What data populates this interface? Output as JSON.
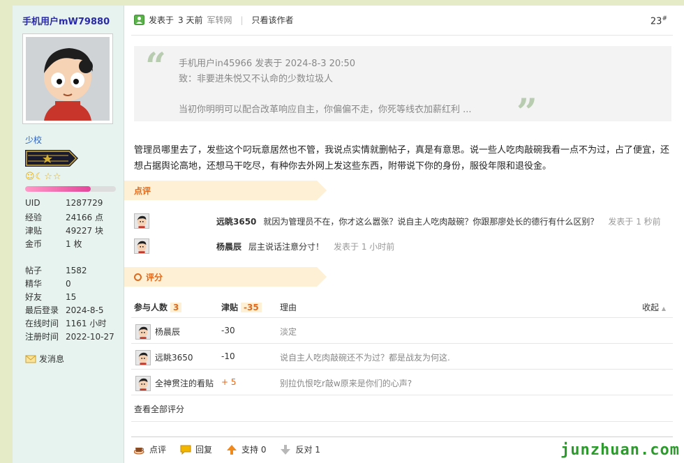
{
  "user": {
    "name": "手机用户mW79880",
    "rank": "少校",
    "level_progress": 0.72,
    "stats": [
      {
        "label": "UID",
        "value": "1287729"
      },
      {
        "label": "经验",
        "value": "24166 点"
      },
      {
        "label": "津贴",
        "value": "49227 块"
      },
      {
        "label": "金币",
        "value": "1 枚"
      }
    ],
    "stats2": [
      {
        "label": "帖子",
        "value": "1582"
      },
      {
        "label": "精华",
        "value": "0"
      },
      {
        "label": "好友",
        "value": "15"
      },
      {
        "label": "最后登录",
        "value": "2024-8-5"
      },
      {
        "label": "在线时间",
        "value": "1161 小时"
      },
      {
        "label": "注册时间",
        "value": "2022-10-27"
      }
    ],
    "message_label": "发消息"
  },
  "post": {
    "posted_prefix": "发表于",
    "posted_time": "3 天前",
    "source": "军转网",
    "only_author": "只看该作者",
    "floor": "23",
    "floor_mark": "#",
    "quote": {
      "open_mark": "“",
      "close_mark": "”",
      "line1": "手机用户in45966 发表于 2024-8-3 20:50",
      "line2": "致：非要进朱悦又不认命的少数垃圾人",
      "line3": "当初你明明可以配合改革响应自主，你偏偏不走，你死等线衣加薪红利 ..."
    },
    "body": "管理员哪里去了，发些这个叼玩意居然也不管，我说点实情就删帖子，真是有意思。说一些人吃肉敲碗我看一点不为过，占了便宜，还想占据舆论高地，还想马干吃尽，有种你去外网上发这些东西，附带说下你的身份，服役年限和退役金。"
  },
  "comments": {
    "title": "点评",
    "items": [
      {
        "author": "远眺3650",
        "text": "就因为管理员不在，你才这么嚣张？说自主人吃肉敲碗？你跟那廖处长的德行有什么区别？",
        "time": "发表于 1 秒前"
      },
      {
        "author": "杨晨辰",
        "text": "层主说话注意分寸！",
        "time": "发表于 1 小时前"
      }
    ]
  },
  "rating": {
    "title": "评分",
    "participants_label": "参与人数",
    "participants_count": "3",
    "allowance_label": "津贴",
    "allowance_total": "-35",
    "reason_label": "理由",
    "collapse_label": "收起",
    "collapse_mark": "▲",
    "rows": [
      {
        "name": "杨晨辰",
        "score": "-30",
        "reason": "淡定"
      },
      {
        "name": "远眺3650",
        "score": "-10",
        "reason": "说自主人吃肉敲碗还不为过？都是战友为何这."
      },
      {
        "name": "全神贯注的看贴",
        "score": "+ 5",
        "reason": "别拉仇恨吃r敲w原来是你们的心声?"
      }
    ],
    "view_all": "查看全部评分"
  },
  "actions": {
    "comment": "点评",
    "reply": "回复",
    "support": "支持 0",
    "oppose": "反对 1"
  },
  "watermark": "junzhuan.com",
  "colors": {
    "accent": "#e2691b",
    "username": "#2a2aa8",
    "link": "#2a63c4",
    "positive": "#e2691b"
  }
}
